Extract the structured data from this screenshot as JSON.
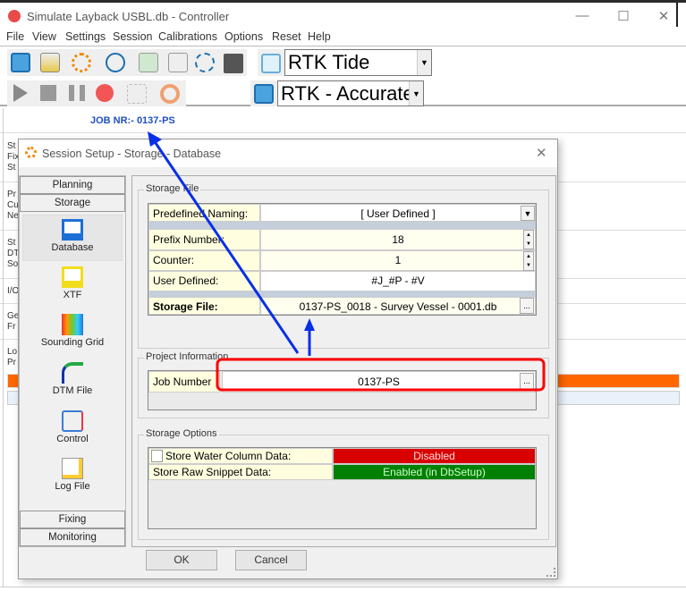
{
  "window": {
    "title": "Simulate Layback USBL.db - Controller",
    "minimize": "—",
    "maximize": "☐",
    "close": "✕"
  },
  "menu": [
    "File",
    "View",
    "Settings",
    "Session",
    "Calibrations",
    "Options",
    "Reset",
    "Help"
  ],
  "toolbar": {
    "tide_combo": "RTK Tide",
    "accuracy_combo": "RTK - Accurate"
  },
  "job": {
    "label": "JOB NR:- 0137-PS"
  },
  "background_rows": [
    [
      "St",
      "Fix",
      "St"
    ],
    [
      "Pr",
      "Cu",
      "Ne"
    ],
    [
      "St",
      "DT",
      "So"
    ],
    [
      "I/O"
    ],
    [
      "Ge",
      "Fr"
    ],
    [
      "Lo",
      "Pr"
    ]
  ],
  "background_colors": {
    "orange_bar": "#ff6600",
    "light_bar": "#eaf1fb"
  },
  "dialog": {
    "title": "Session Setup - Storage - Database",
    "close": "✕",
    "nav": {
      "headers_top": [
        "Planning",
        "Storage"
      ],
      "items": [
        "Database",
        "XTF",
        "Sounding Grid",
        "DTM File",
        "Control",
        "Log File"
      ],
      "headers_bottom": [
        "Fixing",
        "Monitoring"
      ],
      "selected": "Database"
    },
    "storage_file": {
      "group": "Storage File",
      "predefined_label": "Predefined Naming:",
      "predefined_value": "[ User Defined ]",
      "prefix_label": "Prefix Number:",
      "prefix_value": "18",
      "counter_label": "Counter:",
      "counter_value": "1",
      "user_label": "User Defined:",
      "user_value": "#J_#P - #V",
      "file_label": "Storage File:",
      "file_value": "0137-PS_0018 - Survey Vessel - 0001.db",
      "browse": "..."
    },
    "project": {
      "group": "Project Information",
      "job_label": "Job Number",
      "job_value": "0137-PS",
      "browse": "..."
    },
    "options": {
      "group": "Storage Options",
      "water_label": "Store Water Column Data:",
      "water_value": "Disabled",
      "water_checked": false,
      "snippet_label": "Store Raw Snippet Data:",
      "snippet_value": "Enabled (in DbSetup)"
    },
    "ok": "OK",
    "cancel": "Cancel"
  },
  "annotation_colors": {
    "arrow": "#0a2fe8",
    "highlight": "#ff0000",
    "disabled": "#d90000",
    "enabled": "#008000"
  }
}
